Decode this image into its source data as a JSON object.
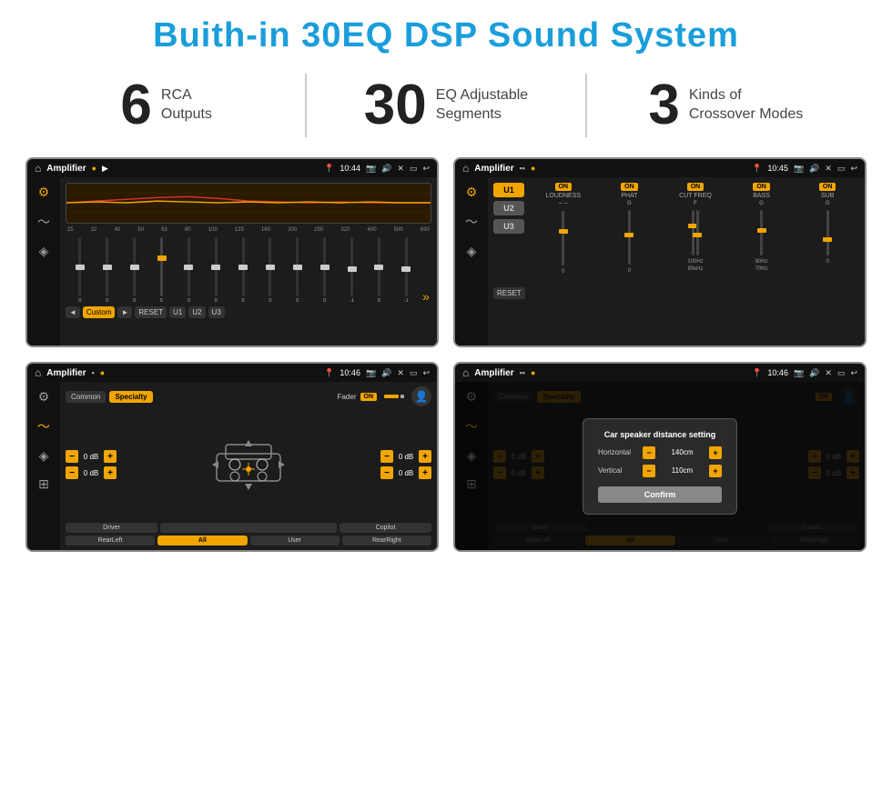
{
  "title": "Buith-in 30EQ DSP Sound System",
  "stats": [
    {
      "number": "6",
      "line1": "RCA",
      "line2": "Outputs"
    },
    {
      "number": "30",
      "line1": "EQ Adjustable",
      "line2": "Segments"
    },
    {
      "number": "3",
      "line1": "Kinds of",
      "line2": "Crossover Modes"
    }
  ],
  "screens": {
    "eq": {
      "appName": "Amplifier",
      "time": "10:44",
      "freqLabels": [
        "25",
        "32",
        "40",
        "50",
        "63",
        "80",
        "100",
        "125",
        "160",
        "200",
        "250",
        "320",
        "400",
        "500",
        "630"
      ],
      "sliderVals": [
        "0",
        "0",
        "0",
        "5",
        "0",
        "0",
        "0",
        "0",
        "0",
        "0",
        "-1",
        "0",
        "-1"
      ],
      "controls": [
        "◄",
        "Custom",
        "►",
        "RESET",
        "U1",
        "U2",
        "U3"
      ]
    },
    "crossover": {
      "appName": "Amplifier",
      "time": "10:45",
      "presets": [
        "U1",
        "U2",
        "U3"
      ],
      "channels": [
        {
          "on": true,
          "label": "LOUDNESS"
        },
        {
          "on": true,
          "label": "PHAT"
        },
        {
          "on": true,
          "label": "CUT FREQ"
        },
        {
          "on": true,
          "label": "BASS"
        },
        {
          "on": true,
          "label": "SUB"
        }
      ],
      "resetLabel": "RESET"
    },
    "fader": {
      "appName": "Amplifier",
      "time": "10:46",
      "tabs": [
        "Common",
        "Specialty"
      ],
      "faderLabel": "Fader",
      "onLabel": "ON",
      "dbValues": [
        "0 dB",
        "0 dB",
        "0 dB",
        "0 dB"
      ],
      "bottomBtns": [
        "Driver",
        "",
        "Copilot",
        "RearLeft",
        "All",
        "User",
        "RearRight"
      ]
    },
    "dialog": {
      "appName": "Amplifier",
      "time": "10:46",
      "tabs": [
        "Common",
        "Specialty"
      ],
      "title": "Car speaker distance setting",
      "horizontal": {
        "label": "Horizontal",
        "value": "140cm"
      },
      "vertical": {
        "label": "Vertical",
        "value": "110cm"
      },
      "confirmLabel": "Confirm",
      "bottomBtns": [
        "Driver",
        "Copilot",
        "RearLeft",
        "All",
        "User",
        "RearRight"
      ]
    }
  }
}
